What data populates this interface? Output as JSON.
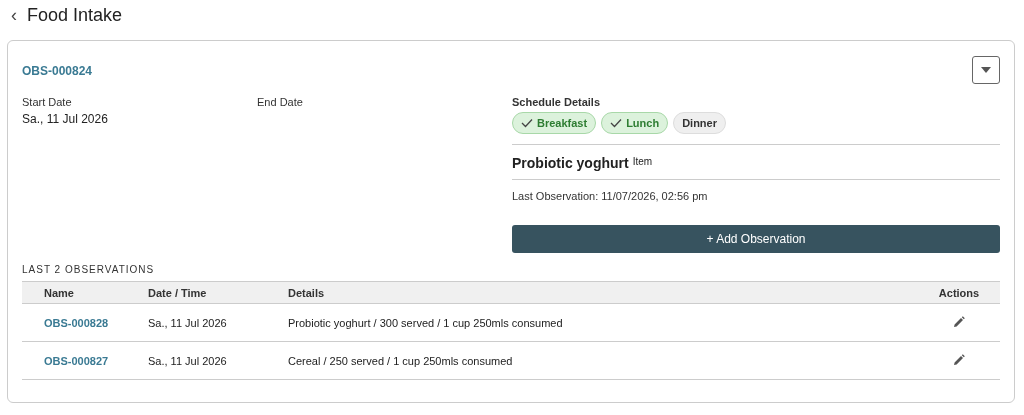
{
  "page": {
    "back": "‹",
    "title": "Food Intake"
  },
  "card": {
    "id": "OBS-000824",
    "start_date": {
      "label": "Start Date",
      "value": "Sa., 11 Jul 2026"
    },
    "end_date": {
      "label": "End Date"
    },
    "schedule": {
      "label": "Schedule Details",
      "meals": [
        {
          "label": "Breakfast",
          "checked": true
        },
        {
          "label": "Lunch",
          "checked": true
        },
        {
          "label": "Dinner",
          "checked": false
        }
      ]
    },
    "item": {
      "name": "Probiotic yoghurt",
      "caption": "Item"
    },
    "last_observation": "Last Observation: 11/07/2026, 02:56 pm",
    "add_button": "+ Add Observation",
    "table": {
      "title": "LAST 2 OBSERVATIONS",
      "columns": [
        "Name",
        "Date / Time",
        "Details",
        "Actions"
      ],
      "rows": [
        {
          "name": "OBS-000828",
          "date": "Sa., 11 Jul 2026",
          "details": "Probiotic yoghurt / 300 served / 1 cup 250mls consumed"
        },
        {
          "name": "OBS-000827",
          "date": "Sa., 11 Jul 2026",
          "details": "Cereal / 250 served / 1 cup 250mls consumed"
        }
      ]
    }
  }
}
